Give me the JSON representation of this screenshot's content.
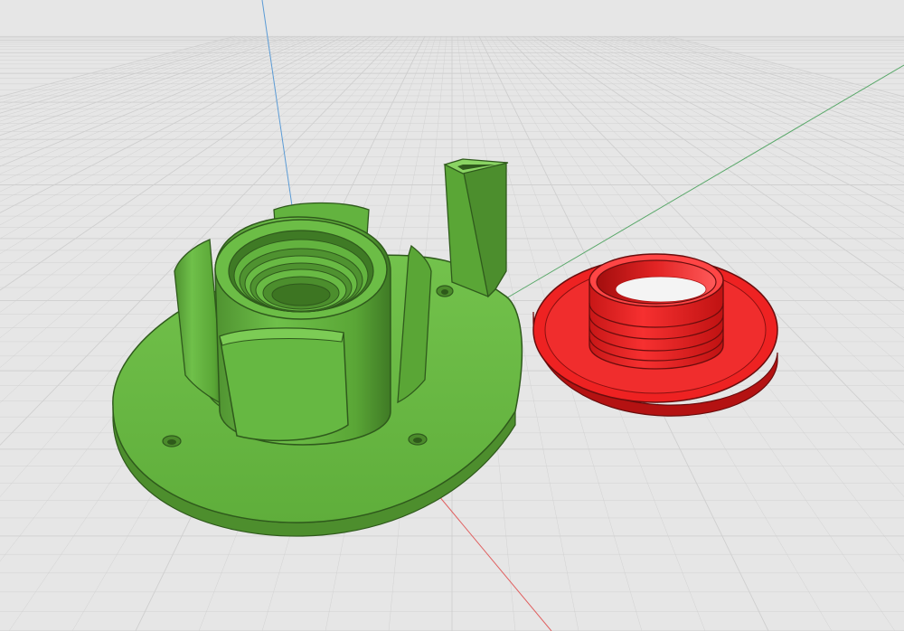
{
  "viewport": {
    "background": "#e6e6e6",
    "grid_color": "#cfcfcf",
    "axes": {
      "x_color": "#e06060",
      "y_color": "#5aa86a",
      "z_color": "#5b9bd5"
    }
  },
  "models": [
    {
      "name": "base-with-threaded-socket",
      "color": "#6abd45",
      "edge_color": "#2f5a1c"
    },
    {
      "name": "threaded-flange-ring",
      "color": "#ee2222",
      "edge_color": "#6a0d0d"
    }
  ]
}
